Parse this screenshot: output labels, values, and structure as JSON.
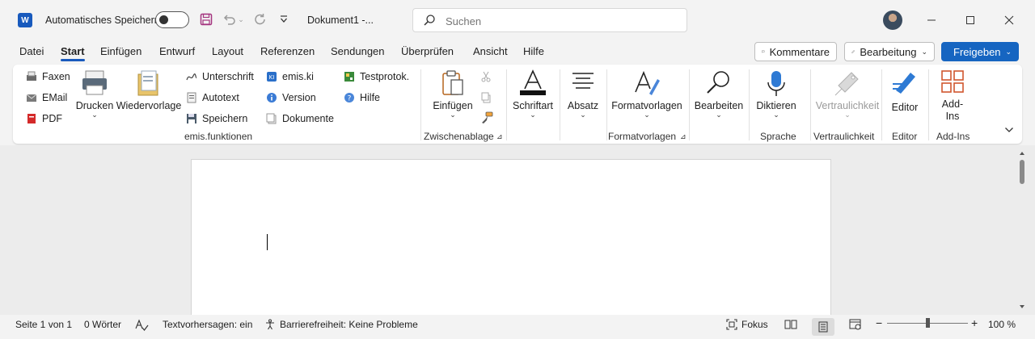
{
  "titlebar": {
    "app_logo_letter": "W",
    "autosave_label": "Automatisches Speichern",
    "doc_title": "Dokument1  -...",
    "search_placeholder": "Suchen"
  },
  "tabs": [
    "Datei",
    "Start",
    "Einfügen",
    "Entwurf",
    "Layout",
    "Referenzen",
    "Sendungen",
    "Überprüfen",
    "Ansicht",
    "Hilfe"
  ],
  "active_tab": "Start",
  "actions": {
    "comments": "Kommentare",
    "editing": "Bearbeitung",
    "share": "Freigeben"
  },
  "ribbon": {
    "emis": {
      "col1": [
        "Faxen",
        "EMail",
        "PDF"
      ],
      "drucken": "Drucken",
      "wiedervorlage": "Wiedervorlage",
      "col3": [
        "Unterschrift",
        "Autotext",
        "Speichern"
      ],
      "col4": [
        "emis.ki",
        "Version",
        "Dokumente"
      ],
      "col5": [
        "Testprotok.",
        "Hilfe"
      ],
      "group_label": "emis.funktionen"
    },
    "clipboard": {
      "paste": "Einfügen",
      "group_label": "Zwischenablage"
    },
    "font": {
      "label": "Schriftart"
    },
    "paragraph": {
      "label": "Absatz"
    },
    "styles": {
      "label": "Formatvorlagen",
      "group_label": "Formatvorlagen"
    },
    "editing": {
      "label": "Bearbeiten"
    },
    "voice": {
      "label": "Diktieren",
      "group_label": "Sprache"
    },
    "sensitivity": {
      "label": "Vertraulichkeit",
      "group_label": "Vertraulichkeit"
    },
    "editor": {
      "label": "Editor",
      "group_label": "Editor"
    },
    "addins": {
      "label_line1": "Add-",
      "label_line2": "Ins",
      "group_label": "Add-Ins"
    }
  },
  "status": {
    "page": "Seite 1 von 1",
    "words": "0 Wörter",
    "predictions": "Textvorhersagen: ein",
    "accessibility": "Barrierefreiheit: Keine Probleme",
    "focus": "Fokus",
    "zoom": "100 %"
  },
  "colors": {
    "accent": "#185abd",
    "share_button": "#1665c1"
  }
}
